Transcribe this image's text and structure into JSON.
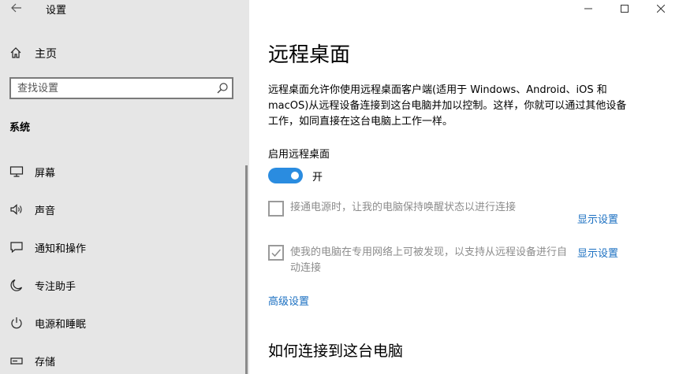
{
  "window": {
    "title": "设置"
  },
  "nav": {
    "home_label": "主页",
    "search_placeholder": "查找设置",
    "section_header": "系统",
    "items": [
      {
        "label": "屏幕",
        "icon": "monitor-icon"
      },
      {
        "label": "声音",
        "icon": "speaker-icon"
      },
      {
        "label": "通知和操作",
        "icon": "notification-icon"
      },
      {
        "label": "专注助手",
        "icon": "moon-icon"
      },
      {
        "label": "电源和睡眠",
        "icon": "power-icon"
      },
      {
        "label": "存储",
        "icon": "storage-icon"
      }
    ]
  },
  "main": {
    "title": "远程桌面",
    "description": "远程桌面允许你使用远程桌面客户端(适用于 Windows、Android、iOS 和 macOS)从远程设备连接到这台电脑并加以控制。这样，你就可以通过其他设备工作，如同直接在这台电脑上工作一样。",
    "enable_label": "启用远程桌面",
    "toggle": {
      "state_label": "开",
      "on": true
    },
    "option_awake": {
      "label": "接通电源时，让我的电脑保持唤醒状态以进行连接",
      "checked": false,
      "link": "显示设置"
    },
    "option_discover": {
      "label": "使我的电脑在专用网络上可被发现，以支持从远程设备进行自动连接",
      "checked": true,
      "link": "显示设置"
    },
    "advanced_link": "高级设置",
    "how_to_connect_heading": "如何连接到这台电脑"
  },
  "colors": {
    "accent": "#2a8ce0",
    "link": "#1a6fc1",
    "nav_background": "#e6e6e6",
    "disabled_text": "#8c8c8c"
  }
}
